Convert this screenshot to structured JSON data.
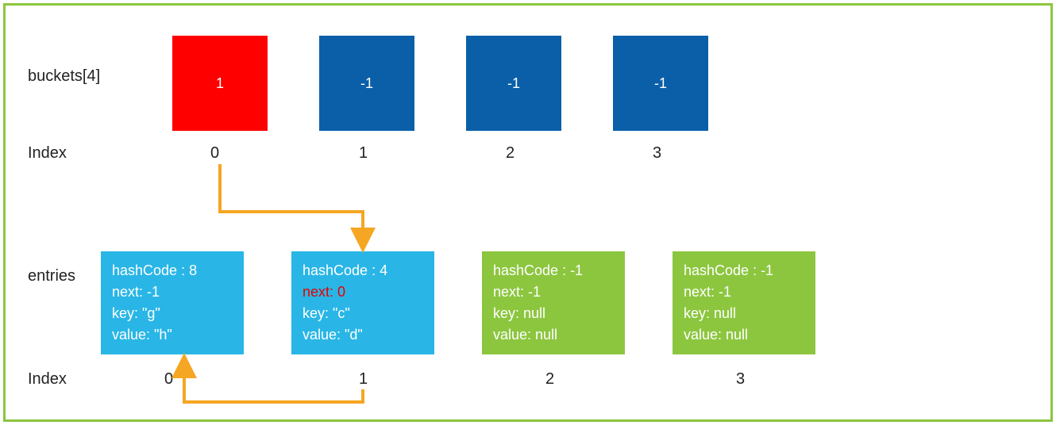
{
  "labels": {
    "buckets": "buckets[4]",
    "index": "Index",
    "entries": "entries"
  },
  "colors": {
    "red": "#ff0000",
    "blue": "#0a5fa8",
    "lightblue": "#29b6e6",
    "green": "#8cc63f",
    "orange": "#f5a623"
  },
  "buckets": [
    {
      "value": "1",
      "color": "red",
      "index": "0"
    },
    {
      "value": "-1",
      "color": "blue",
      "index": "1"
    },
    {
      "value": "-1",
      "color": "blue",
      "index": "2"
    },
    {
      "value": "-1",
      "color": "blue",
      "index": "3"
    }
  ],
  "entries": [
    {
      "hashCode": "hashCode : 8",
      "next": "next: -1",
      "nextRed": false,
      "key": "key: \"g\"",
      "value": "value: \"h\"",
      "color": "lightblue",
      "index": "0"
    },
    {
      "hashCode": "hashCode : 4",
      "next": "next: 0",
      "nextRed": true,
      "key": "key: \"c\"",
      "value": "value: \"d\"",
      "color": "lightblue",
      "index": "1"
    },
    {
      "hashCode": "hashCode : -1",
      "next": "next: -1",
      "nextRed": false,
      "key": "key: null",
      "value": "value: null",
      "color": "green",
      "index": "2"
    },
    {
      "hashCode": "hashCode : -1",
      "next": "next: -1",
      "nextRed": false,
      "key": "key: null",
      "value": "value: null",
      "color": "green",
      "index": "3"
    }
  ]
}
